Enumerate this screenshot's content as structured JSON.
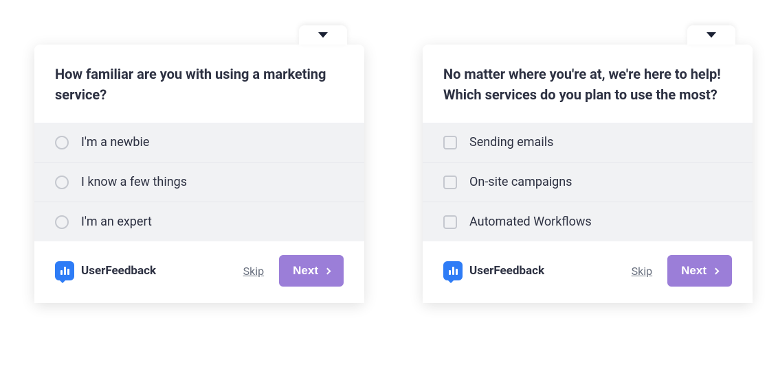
{
  "survey_left": {
    "question": "How familiar are you with using a marketing service?",
    "input_type": "radio",
    "options": [
      {
        "label": "I'm a newbie"
      },
      {
        "label": "I know a few things"
      },
      {
        "label": "I'm an expert"
      }
    ]
  },
  "survey_right": {
    "question": "No matter where you're at, we're here to help! Which services do you plan to use the most?",
    "input_type": "checkbox",
    "options": [
      {
        "label": "Sending emails"
      },
      {
        "label": "On-site campaigns"
      },
      {
        "label": "Automated Workflows"
      }
    ]
  },
  "footer": {
    "brand": "UserFeedback",
    "skip_label": "Skip",
    "next_label": "Next"
  },
  "colors": {
    "accent_purple": "#9b7ed8",
    "brand_blue": "#2e7cf6",
    "text_dark": "#2d3142",
    "option_bg": "#f1f2f4"
  }
}
